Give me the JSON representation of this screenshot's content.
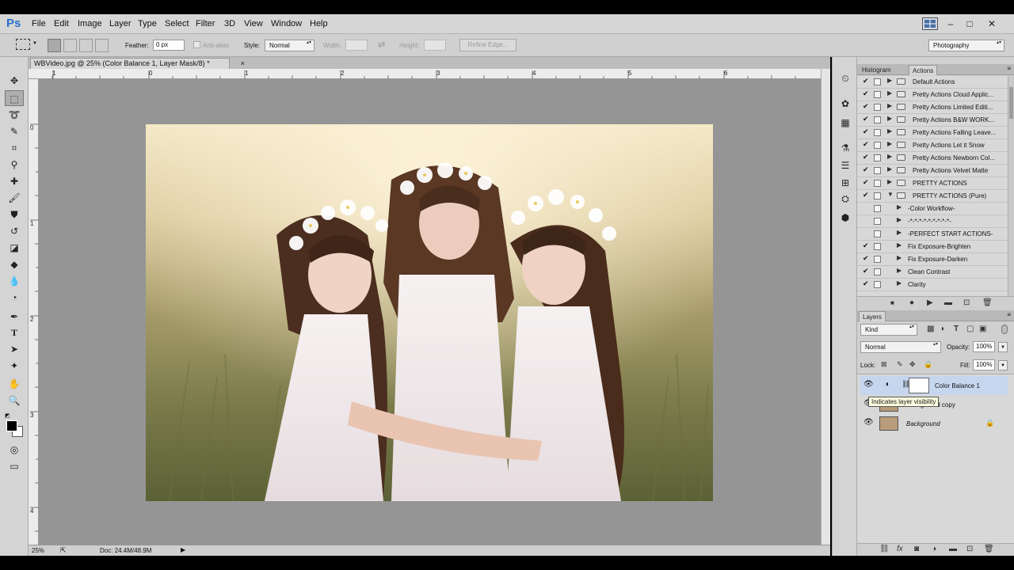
{
  "app": {
    "logo": "Ps"
  },
  "menu": [
    "File",
    "Edit",
    "Image",
    "Layer",
    "Type",
    "Select",
    "Filter",
    "3D",
    "View",
    "Window",
    "Help"
  ],
  "window_controls": {
    "minimize": "–",
    "restore": "□",
    "close": "✕"
  },
  "options": {
    "feather_label": "Feather:",
    "feather_value": "0 px",
    "antialias_label": "Anti-alias",
    "style_label": "Style:",
    "style_value": "Normal",
    "width_label": "Width:",
    "height_label": "Height:",
    "refine_edge": "Refine Edge...",
    "workspace": "Photography"
  },
  "document": {
    "tab_title": "WBVideo.jpg @ 25% (Color Balance 1, Layer Mask/8) *",
    "close": "×",
    "ruler_top": [
      "1",
      "0",
      "1",
      "2",
      "3",
      "4",
      "5",
      "6"
    ],
    "ruler_left": [
      "0",
      "1",
      "2",
      "3",
      "4"
    ]
  },
  "status": {
    "zoom": "25%",
    "doc": "Doc: 24.4M/48.9M"
  },
  "actions_panel": {
    "tabs": [
      "Histogram",
      "Actions"
    ],
    "active_tab": "Actions",
    "rows": [
      {
        "label": "Default Actions",
        "checked": true,
        "level": 0
      },
      {
        "label": "Pretty Actions Cloud Applic...",
        "checked": true,
        "level": 0
      },
      {
        "label": "Pretty Actions Limited Editi...",
        "checked": true,
        "level": 0
      },
      {
        "label": "Pretty Actions B&W WORK...",
        "checked": true,
        "level": 0
      },
      {
        "label": "Pretty Actions Falling Leave...",
        "checked": true,
        "level": 0
      },
      {
        "label": "Pretty Actions Let it Snow",
        "checked": true,
        "level": 0
      },
      {
        "label": "Pretty Actions Newborn Col...",
        "checked": true,
        "level": 0
      },
      {
        "label": "Pretty Actions Velvet Matte",
        "checked": true,
        "level": 0
      },
      {
        "label": "PRETTY ACTIONS",
        "checked": true,
        "level": 0
      },
      {
        "label": "PRETTY ACTIONS (Pure)",
        "checked": true,
        "level": 0,
        "open": true
      },
      {
        "label": "-Color Workflow-",
        "checked": false,
        "level": 1
      },
      {
        "label": "-*-*-*-*-*-*-*-*-*-",
        "checked": false,
        "level": 1
      },
      {
        "label": "-PERFECT START ACTIONS-",
        "checked": false,
        "level": 1
      },
      {
        "label": "Fix Exposure-Brighten",
        "checked": true,
        "level": 1
      },
      {
        "label": "Fix Exposure-Darken",
        "checked": true,
        "level": 1
      },
      {
        "label": "Clean Contrast",
        "checked": true,
        "level": 1
      },
      {
        "label": "Clarity",
        "checked": true,
        "level": 1
      }
    ]
  },
  "layers_panel": {
    "title": "Layers",
    "kind": "Kind",
    "blend_mode": "Normal",
    "opacity_label": "Opacity:",
    "opacity_value": "100%",
    "lock_label": "Lock:",
    "fill_label": "Fill:",
    "fill_value": "100%",
    "layers": [
      {
        "name": "Color Balance 1",
        "selected": true
      },
      {
        "name": "Background copy",
        "selected": false
      },
      {
        "name": "Background",
        "selected": false
      }
    ],
    "tooltip": "Indicates layer visibility"
  }
}
